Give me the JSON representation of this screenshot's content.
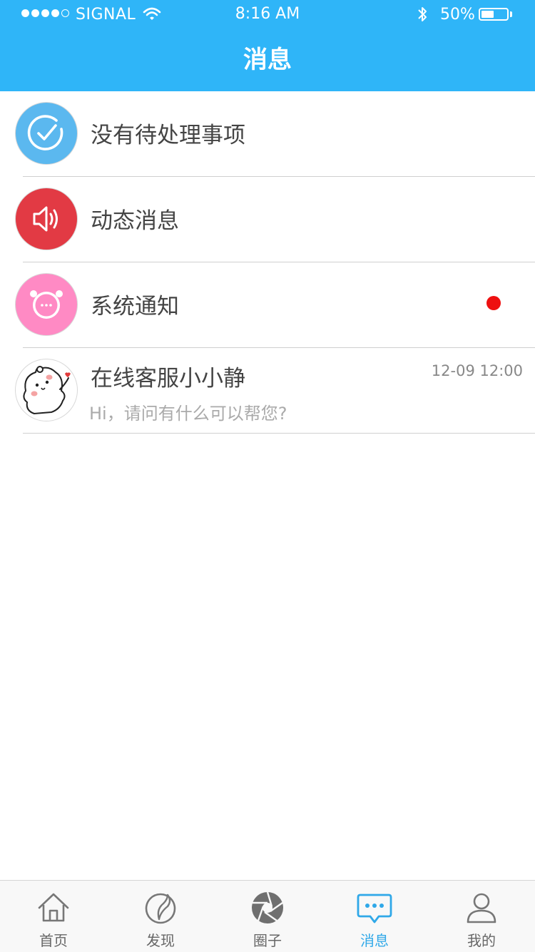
{
  "status_bar": {
    "carrier": "SIGNAL",
    "time": "8:16 AM",
    "battery_percent": "50%",
    "battery_level": 0.5,
    "signal_bars": 4
  },
  "header": {
    "title": "消息",
    "background_color": "#2fb5f8"
  },
  "list": [
    {
      "title": "没有待处理事项",
      "icon": "check-circle-icon",
      "icon_bg": "#5bb8ef"
    },
    {
      "title": "动态消息",
      "icon": "speaker-icon",
      "icon_bg": "#e23a44"
    },
    {
      "title": "系统通知",
      "icon": "chat-bubble-icon",
      "icon_bg": "#ff8ac4",
      "unread": true
    },
    {
      "title": "在线客服小小静",
      "subtitle": "Hi，请问有什么可以帮您?",
      "time": "12-09 12:00",
      "icon": "bear-avatar-icon"
    }
  ],
  "tabbar": {
    "active_color": "#2fa8e8",
    "tabs": [
      {
        "label": "首页",
        "icon": "home-icon"
      },
      {
        "label": "发现",
        "icon": "discover-icon"
      },
      {
        "label": "圈子",
        "icon": "aperture-icon"
      },
      {
        "label": "消息",
        "icon": "message-icon",
        "active": true
      },
      {
        "label": "我的",
        "icon": "user-icon"
      }
    ]
  }
}
